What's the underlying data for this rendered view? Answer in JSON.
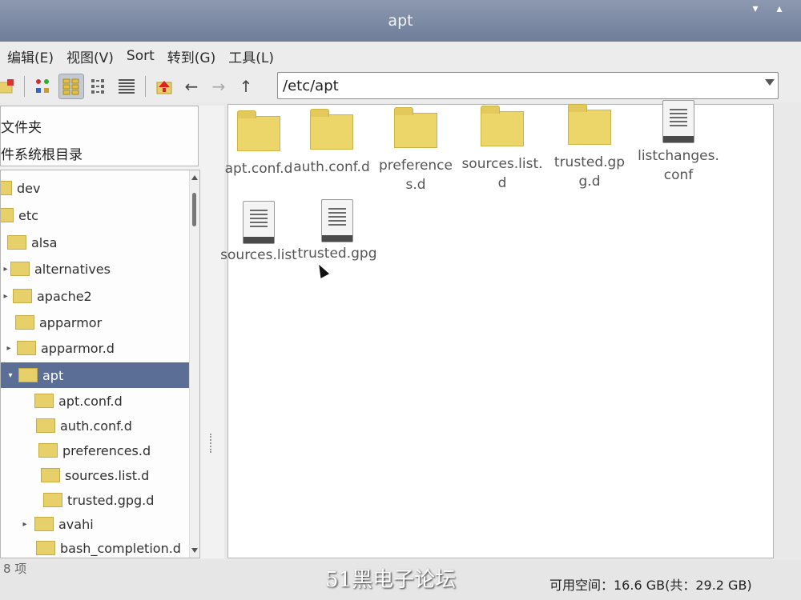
{
  "window": {
    "title": "apt"
  },
  "menu": {
    "items": [
      "编辑(E)",
      "视图(V)",
      "Sort",
      "转到(G)",
      "工具(L)"
    ]
  },
  "toolbar": {
    "icons": [
      "new-folder-icon",
      "view-icons-icon",
      "view-thumbnails-icon",
      "view-compact-icon",
      "view-list-icon",
      "home-icon",
      "back-arrow-icon",
      "forward-arrow-icon",
      "up-arrow-icon"
    ],
    "path": "/etc/apt"
  },
  "places": {
    "items": [
      "文件夹",
      "件系统根目录"
    ]
  },
  "tree": {
    "items": [
      {
        "label": "dev",
        "expander": ""
      },
      {
        "label": "etc",
        "expander": ""
      },
      {
        "label": "alsa",
        "expander": ""
      },
      {
        "label": "alternatives",
        "expander": "▸"
      },
      {
        "label": "apache2",
        "expander": "▸"
      },
      {
        "label": "apparmor",
        "expander": ""
      },
      {
        "label": "apparmor.d",
        "expander": "▸"
      },
      {
        "label": "apt",
        "expander": "▾"
      },
      {
        "label": "apt.conf.d",
        "expander": ""
      },
      {
        "label": "auth.conf.d",
        "expander": ""
      },
      {
        "label": "preferences.d",
        "expander": ""
      },
      {
        "label": "sources.list.d",
        "expander": ""
      },
      {
        "label": "trusted.gpg.d",
        "expander": ""
      },
      {
        "label": "avahi",
        "expander": "▸"
      },
      {
        "label": "bash_completion.d",
        "expander": ""
      }
    ],
    "selected": "apt"
  },
  "files": [
    {
      "name": "apt.conf.d",
      "type": "folder"
    },
    {
      "name": "auth.conf.d",
      "type": "folder"
    },
    {
      "name": "preferences.d",
      "type": "folder"
    },
    {
      "name": "sources.list.d",
      "type": "folder"
    },
    {
      "name": "trusted.gpg.d",
      "type": "folder"
    },
    {
      "name": "listchanges.conf",
      "type": "file"
    },
    {
      "name": "sources.list",
      "type": "file"
    },
    {
      "name": "trusted.gpg",
      "type": "file"
    }
  ],
  "status": {
    "count": "8 项",
    "free_space": "可用空间：16.6 GB(共：29.2 GB)"
  },
  "watermark": "51黑电子论坛",
  "colors": {
    "titlebar": "#7a88a5",
    "selection": "#5b6f96",
    "folder": "#ecd66a"
  }
}
